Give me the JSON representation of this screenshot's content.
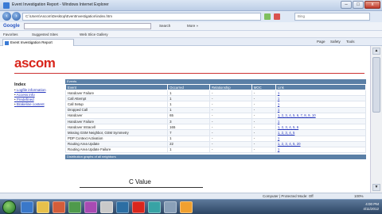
{
  "window": {
    "title": "Event Investigation Report - Windows Internet Explorer",
    "btn_min": "–",
    "btn_max": "□",
    "btn_close": "x"
  },
  "addressbar": {
    "url": "C:\\Users\\Ascom\\Desktop\\EventInvestigation\\index.htm",
    "search_placeholder": "Bing"
  },
  "googlebar": {
    "logo": "Google",
    "search_label": "Search",
    "more_label": "More »"
  },
  "favorites": {
    "favorites_label": "Favorites",
    "suggested_sites": "Suggested Sites",
    "web_slice": "Web Slice Gallery"
  },
  "commandbar": {
    "tab_label": "Event Investigation Report",
    "page_label": "Page",
    "safety_label": "Safety",
    "tools_label": "Tools"
  },
  "page": {
    "logo": "ascom",
    "index_title": "Index",
    "index_items": [
      "Logfile information",
      "Access info",
      "Predefined",
      "Brakeline content"
    ],
    "section_title": "Events",
    "table": {
      "headers": [
        "Event",
        "Occurred",
        "Relationship",
        "MOC",
        "Link"
      ],
      "rows": [
        [
          "Handover Failure",
          "1",
          "-",
          "-",
          "1"
        ],
        [
          "Call Attempt",
          "1",
          "-",
          "-",
          "1"
        ],
        [
          "Call Setup",
          "1",
          "-",
          "-",
          "1"
        ],
        [
          "Dropped Call",
          "1",
          "-",
          "-",
          "1"
        ],
        [
          "Handover",
          "65",
          "-",
          "-",
          "1, 2, 3, 4, 5, 6, 7, 8, 9, 10"
        ],
        [
          "Handover Failure",
          "3",
          "-",
          "-",
          "1"
        ],
        [
          "Handover Intracell",
          "165",
          "-",
          "-",
          "1, 2, 3, 4, 5, 6"
        ],
        [
          "Missing GSM Neighbor, GSM Symmetry",
          "7",
          "-",
          "-",
          "1, 2, 3, 4, 5"
        ],
        [
          "PDP Context Activation",
          "1",
          "-",
          "-",
          "1"
        ],
        [
          "Routing Area Update",
          "22",
          "-",
          "-",
          "1, 2, 3, 4, 5, 20"
        ],
        [
          "Routing Area Update Failure",
          "1",
          "-",
          "-",
          "1"
        ]
      ]
    },
    "section2_title": "Distribution graphs of all neighbors",
    "chart_caption": "C Value"
  },
  "statusbar": {
    "zone": "Computer | Protected Mode: Off",
    "zoom": "100%"
  },
  "taskbar": {
    "time": "4:00 PM",
    "date": "4/11/2012"
  },
  "colors": {
    "brand": "#d9261c",
    "table_header": "#5a7fa6",
    "link": "#2233bb"
  }
}
